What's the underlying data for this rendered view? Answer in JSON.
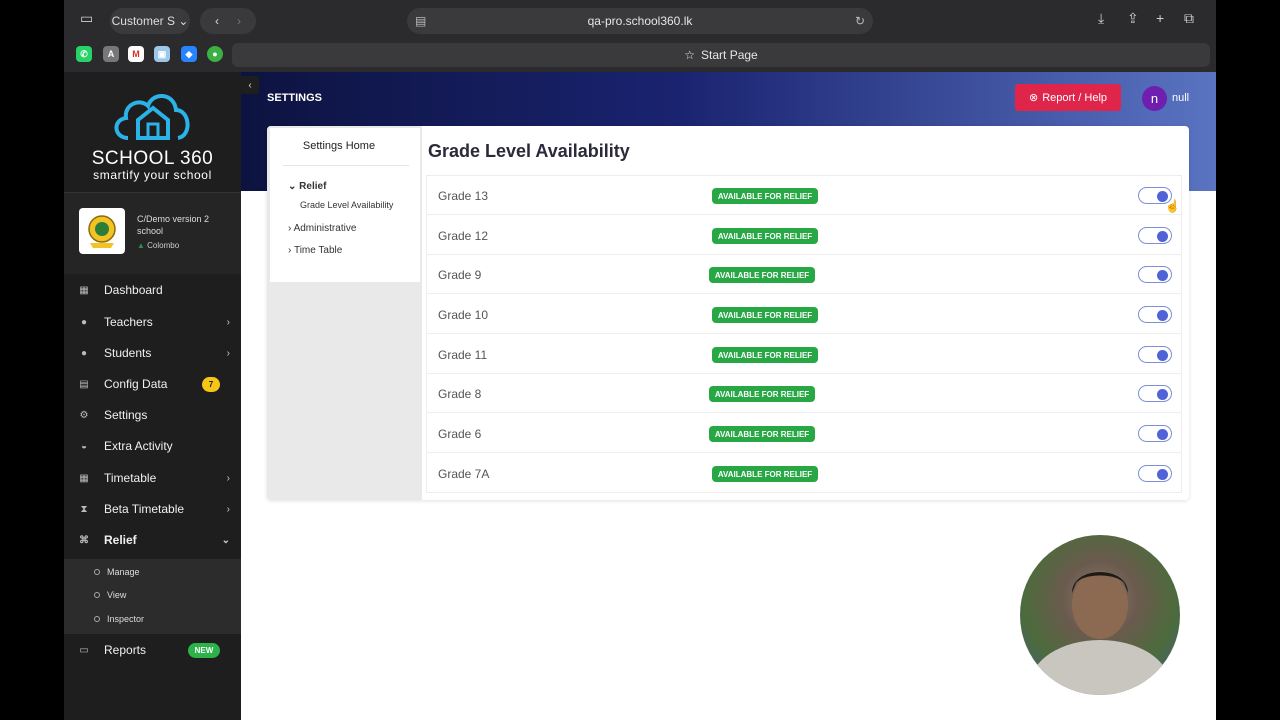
{
  "browser": {
    "tab_group": "Customer S",
    "url": "qa-pro.school360.lk",
    "start_page": "Start Page",
    "bookmarks": [
      "whatsapp-icon",
      "a-icon",
      "gmail-icon",
      "app-icon",
      "jira-icon",
      "green-icon"
    ]
  },
  "brand": {
    "title": "SCHOOL 360",
    "tagline": "smartify your school"
  },
  "school": {
    "name": "C/Demo version 2 school",
    "location": "Colombo"
  },
  "sidebar": {
    "items": [
      {
        "label": "Dashboard"
      },
      {
        "label": "Teachers"
      },
      {
        "label": "Students"
      },
      {
        "label": "Config Data",
        "badge": "7"
      },
      {
        "label": "Settings"
      },
      {
        "label": "Extra Activity"
      },
      {
        "label": "Timetable"
      },
      {
        "label": "Beta Timetable"
      },
      {
        "label": "Relief"
      },
      {
        "label": "Reports",
        "badge": "NEW"
      }
    ],
    "relief_sub": [
      "Manage",
      "View",
      "Inspector"
    ]
  },
  "header": {
    "section": "SETTINGS",
    "report_label": "Report / Help",
    "avatar_initial": "n",
    "username": "null"
  },
  "settings_nav": {
    "home": "Settings Home",
    "relief": "Relief",
    "relief_child": "Grade Level Availability",
    "administrative": "Administrative",
    "timetable": "Time Table"
  },
  "panel": {
    "title": "Grade Level Availability"
  },
  "grades": [
    {
      "name": "Grade 13",
      "status": "AVAILABLE FOR RELIEF"
    },
    {
      "name": "Grade 12",
      "status": "AVAILABLE FOR RELIEF"
    },
    {
      "name": "Grade 9",
      "status": "AVAILABLE FOR RELIEF"
    },
    {
      "name": "Grade 10",
      "status": "AVAILABLE FOR RELIEF"
    },
    {
      "name": "Grade 11",
      "status": "AVAILABLE FOR RELIEF"
    },
    {
      "name": "Grade 8",
      "status": "AVAILABLE FOR RELIEF"
    },
    {
      "name": "Grade 6",
      "status": "AVAILABLE FOR RELIEF"
    },
    {
      "name": "Grade 7A",
      "status": "AVAILABLE FOR RELIEF"
    }
  ],
  "colors": {
    "accent": "#4f62d6",
    "badge_green": "#28a745",
    "report_red": "#e0254a",
    "avatar_purple": "#6e1fb0"
  }
}
